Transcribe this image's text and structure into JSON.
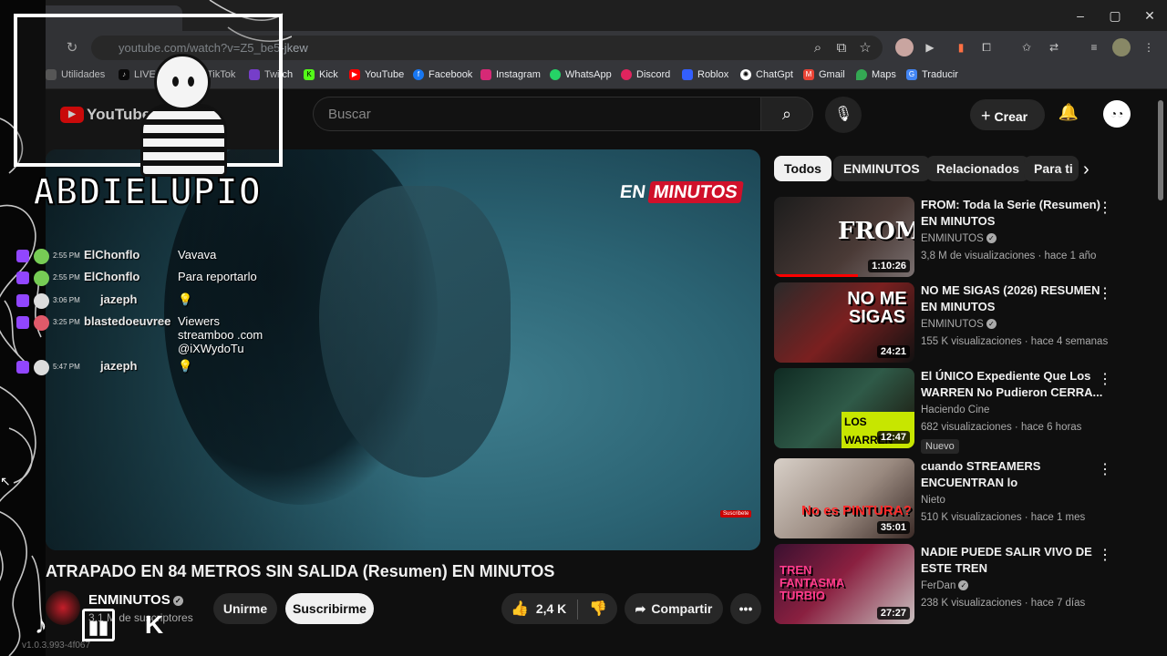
{
  "browser": {
    "tab_title": "",
    "url": "youtube.com/watch?v=Z5_be5-jkew",
    "bookmarks": [
      "Utilidades",
      "LIVE",
      "TikTok",
      "Twitch",
      "Kick",
      "YouTube",
      "Facebook",
      "Instagram",
      "WhatsApp",
      "Discord",
      "Roblox",
      "ChatGpt",
      "Gmail",
      "Maps",
      "Traducir"
    ]
  },
  "yt": {
    "logo_text": "YouTube",
    "search_placeholder": "Buscar",
    "create_label": "Crear"
  },
  "video": {
    "title": "ATRAPADO EN 84 METROS SIN SALIDA (Resumen) EN MINUTOS",
    "overlay_logo_a": "EN",
    "overlay_logo_b": "MINUTOS",
    "channel": "ENMINUTOS",
    "subs": "3,1 M de suscriptores",
    "join_label": "Unirme",
    "subscribe_label": "Suscribirme",
    "likes": "2,4 K",
    "share_label": "Compartir",
    "mini_sub_badge": "Suscribete"
  },
  "chips": [
    "Todos",
    "ENMINUTOS",
    "Relacionados",
    "Para ti"
  ],
  "recs": [
    {
      "title": "FROM: Toda la Serie (Resumen) EN MINUTOS",
      "channel": "ENMINUTOS",
      "verified": true,
      "meta": "3,8 M de visualizaciones · hace 1 año",
      "duration": "1:10:26",
      "thumb_text": "FROM",
      "new": false
    },
    {
      "title": "NO ME SIGAS (2026) RESUMEN EN MINUTOS",
      "channel": "ENMINUTOS",
      "verified": true,
      "meta": "155 K visualizaciones · hace 4 semanas",
      "duration": "24:21",
      "thumb_text": "NO ME SIGAS",
      "new": false
    },
    {
      "title": "El ÚNICO Expediente Que Los WARREN No Pudieron CERRA...",
      "channel": "Haciendo Cine",
      "verified": false,
      "meta": "682 visualizaciones · hace 6 horas",
      "duration": "12:47",
      "thumb_text": "LOS WARREN",
      "new": true,
      "new_label": "Nuevo"
    },
    {
      "title": "cuando STREAMERS ENCUENTRAN lo PERTURBAD...",
      "channel": "Nieto",
      "verified": false,
      "meta": "510 K visualizaciones · hace 1 mes",
      "duration": "35:01",
      "thumb_text": "No es PINTURA?",
      "new": false
    },
    {
      "title": "NADIE PUEDE SALIR VIVO DE ESTE TREN",
      "channel": "FerDan",
      "verified": true,
      "meta": "238 K visualizaciones · hace 7 días",
      "duration": "27:27",
      "thumb_text": "TREN FANTASMA TURBIO",
      "new": false
    }
  ],
  "stream": {
    "streamer": "ABDIELUPIO",
    "version": "v1.0.3.993-4f067",
    "chat": [
      {
        "time": "2:55 PM",
        "user": "ElChonflo",
        "msg": "Vavava"
      },
      {
        "time": "2:55 PM",
        "user": "ElChonflo",
        "msg": "Para reportarlo"
      },
      {
        "time": "3:06 PM",
        "user": "jazeph",
        "msg": "💡"
      },
      {
        "time": "3:25 PM",
        "user": "blastedoeuvree",
        "msg": "Viewers streamboo .com @iXWydoTu"
      },
      {
        "time": "5:47 PM",
        "user": "jazeph",
        "msg": "💡"
      }
    ]
  },
  "colors": {
    "accent_red": "#d0102a",
    "twitch_purple": "#9146ff",
    "bg": "#0f0f0f"
  },
  "icons": [
    "search-icon",
    "mic-icon",
    "bell-icon",
    "like-icon",
    "dislike-icon",
    "share-icon",
    "kebab-icon",
    "tiktok-icon",
    "twitch-icon",
    "kick-icon"
  ]
}
